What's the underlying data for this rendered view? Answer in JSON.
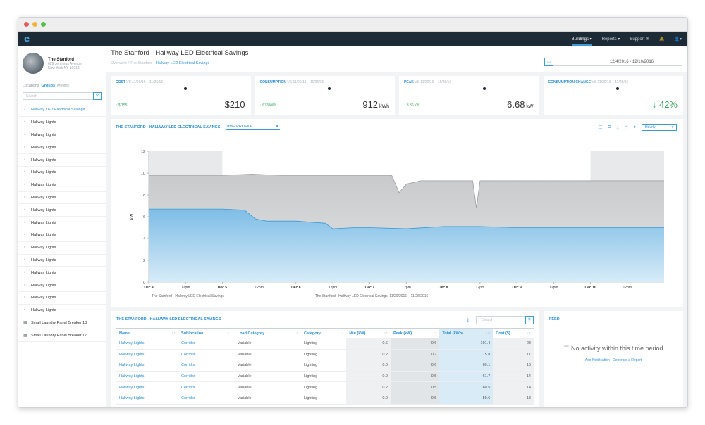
{
  "window": {
    "dots": [
      "#e35d5b",
      "#f0b43b",
      "#57c04b"
    ]
  },
  "topnav": {
    "logo": "e",
    "items": [
      "Buildings ▾",
      "Reports ▾",
      "Support ✉"
    ],
    "bell": "🔔",
    "user": "👤▾"
  },
  "sidebar": {
    "building_name": "The Stanford",
    "address_line1": "629 Jennings Avenue",
    "address_line2": "New York NY 10018",
    "tabs": [
      "Locations",
      "Groups",
      "Meters"
    ],
    "search_placeholder": "Search",
    "items": [
      {
        "icon": "←",
        "label": "Hallway LED Electrical Savings"
      },
      {
        "icon": "♀",
        "label": "Hallway Lights"
      },
      {
        "icon": "♀",
        "label": "Hallway Lights"
      },
      {
        "icon": "♀",
        "label": "Hallway Lights"
      },
      {
        "icon": "♀",
        "label": "Hallway Lights"
      },
      {
        "icon": "♀",
        "label": "Hallway Lights"
      },
      {
        "icon": "♀",
        "label": "Hallway Lights"
      },
      {
        "icon": "♀",
        "label": "Hallway Lights"
      },
      {
        "icon": "♀",
        "label": "Hallway Lights"
      },
      {
        "icon": "♀",
        "label": "Hallway Lights"
      },
      {
        "icon": "♀",
        "label": "Hallway Lights"
      },
      {
        "icon": "♀",
        "label": "Hallway Lights"
      },
      {
        "icon": "♀",
        "label": "Hallway Lights"
      },
      {
        "icon": "♀",
        "label": "Hallway Lights"
      },
      {
        "icon": "♀",
        "label": "Hallway Lights"
      },
      {
        "icon": "♀",
        "label": "Hallway Lights"
      },
      {
        "icon": "♀",
        "label": "Hallway Lights"
      },
      {
        "icon": "▦",
        "label": "Small Laundry Panel Breaker 13"
      },
      {
        "icon": "▦",
        "label": "Small Laundry Panel Breaker 17"
      }
    ]
  },
  "header": {
    "title": "The Stanford - Hallway LED Electrical Savings",
    "crumbs": [
      "Overview",
      "The Stanford",
      "Hallway LED Electrical Savings"
    ],
    "date_range": "12/4/2016 - 12/10/2016"
  },
  "kpis": [
    {
      "label": "COST",
      "vs": "VS 11/20/16 – 11/26/16",
      "delta": "↓ $ 155",
      "value": "$210",
      "unit": "",
      "progress": 0.57
    },
    {
      "label": "CONSUMPTION",
      "vs": "VS 11/20/16 – 11/26/16",
      "delta": "↓ 673 kWh",
      "value": "912",
      "unit": " kWh",
      "progress": 0.57
    },
    {
      "label": "PEAK",
      "vs": "VS 11/20/16 – 11/26/16",
      "delta": "↓ 3.36 kW",
      "value": "6.68",
      "unit": " kW",
      "progress": 0.66
    },
    {
      "label": "CONSUMPTION CHANGE",
      "vs": "VS 11/20/16 – 11/26/16",
      "delta": "",
      "value": "↓ 42%",
      "unit": "",
      "progress": 0.57
    }
  ],
  "chart_card": {
    "title": "THE STANFORD - HALLWAY LED ELECTRICAL SAVINGS",
    "profile": "TIME PROFILE",
    "interval": "Hourly"
  },
  "chart_data": {
    "type": "area",
    "ylabel": "kW",
    "ylim": [
      0,
      12
    ],
    "yticks": [
      0,
      2,
      4,
      6,
      8,
      10,
      12
    ],
    "xticks": [
      "Dec 4",
      "12pm",
      "Dec 5",
      "12pm",
      "Dec 6",
      "12pm",
      "Dec 7",
      "12pm",
      "Dec 8",
      "12pm",
      "Dec 9",
      "12pm",
      "Dec 10",
      "12pm"
    ],
    "x_days": [
      0,
      0.5,
      1,
      1.5,
      2,
      2.5,
      3,
      3.5,
      4,
      4.5,
      5,
      5.5,
      6,
      6.5
    ],
    "xlim": [
      0,
      7
    ],
    "shaded_days": [
      [
        0,
        1
      ],
      [
        6,
        7
      ]
    ],
    "series": [
      {
        "name": "The Stanford - Hallway LED Electrical Savings: 11/20/2016 – 11/26/2016",
        "color": "#c4c6c8",
        "x": [
          0,
          0.3,
          0.6,
          1.0,
          1.4,
          1.8,
          2.2,
          2.6,
          3.0,
          3.3,
          3.4,
          3.5,
          3.7,
          4.0,
          4.4,
          4.45,
          4.5,
          4.8,
          5.2,
          5.6,
          6.0,
          6.4,
          6.8,
          7.0
        ],
        "values": [
          9.8,
          9.8,
          9.8,
          9.8,
          9.9,
          9.8,
          9.8,
          9.8,
          9.8,
          9.8,
          8.2,
          9.0,
          9.3,
          9.3,
          9.3,
          6.8,
          9.3,
          9.3,
          9.3,
          9.3,
          9.3,
          9.3,
          9.3,
          9.3
        ]
      },
      {
        "name": "The Stanford - Hallway LED Electrical Savings",
        "color": "#7ebde6",
        "x": [
          0,
          0.5,
          1.0,
          1.3,
          1.45,
          1.6,
          2.0,
          2.4,
          2.5,
          2.8,
          3.0,
          3.5,
          4.0,
          4.5,
          5.0,
          5.5,
          6.0,
          6.5,
          7.0
        ],
        "values": [
          6.7,
          6.7,
          6.7,
          6.6,
          5.8,
          5.6,
          5.6,
          5.4,
          4.9,
          5.0,
          5.0,
          4.9,
          5.1,
          5.1,
          5.0,
          5.0,
          5.0,
          5.0,
          5.0
        ]
      }
    ],
    "legend": "bottom"
  },
  "table": {
    "title": "THE STANFORD - HALLWAY LED ELECTRICAL SAVINGS",
    "search_placeholder": "Search",
    "columns": [
      "Name",
      "Sublocation",
      "Load Category",
      "Category",
      "Min (kW)",
      "Peak (kW)",
      "Total (kWh)",
      "Cost ($)"
    ],
    "rows": [
      [
        "Hallway Lights",
        "Corridor",
        "Variable",
        "Lighting",
        "0.6",
        "0.6",
        "101.4",
        "23"
      ],
      [
        "Hallway Lights",
        "Corridor",
        "Variable",
        "Lighting",
        "0.2",
        "0.7",
        "75.8",
        "17"
      ],
      [
        "Hallway Lights",
        "Corridor",
        "Variable",
        "Lighting",
        "0.0",
        "0.6",
        "69.1",
        "16"
      ],
      [
        "Hallway Lights",
        "Corridor",
        "Variable",
        "Lighting",
        "0.0",
        "0.5",
        "61.7",
        "14"
      ],
      [
        "Hallway Lights",
        "Corridor",
        "Variable",
        "Lighting",
        "0.2",
        "0.5",
        "60.5",
        "14"
      ],
      [
        "Hallway Lights",
        "Corridor",
        "Variable",
        "Lighting",
        "0.0",
        "0.5",
        "59.6",
        "13"
      ]
    ]
  },
  "feed": {
    "title": "FEED",
    "empty": "No activity within this time period",
    "links": "Add Notification | Generate a Report"
  }
}
